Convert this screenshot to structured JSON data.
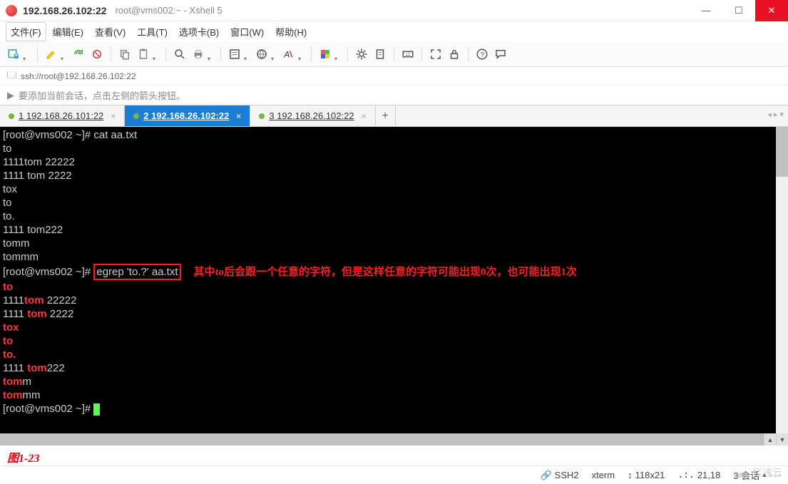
{
  "window": {
    "title_main": "192.168.26.102:22",
    "title_sub": "root@vms002:~ - Xshell 5"
  },
  "menus": [
    "文件(F)",
    "编辑(E)",
    "查看(V)",
    "工具(T)",
    "选项卡(B)",
    "窗口(W)",
    "帮助(H)"
  ],
  "address": "ssh://root@192.168.26.102:22",
  "hint": "要添加当前会话，点击左侧的箭头按钮。",
  "tabs": [
    {
      "label": "1 192.168.26.101:22",
      "active": false
    },
    {
      "label": "2 192.168.26.102:22",
      "active": true
    },
    {
      "label": "3 192.168.26.102:22",
      "active": false
    }
  ],
  "terminal": {
    "prompt1": "[root@vms002 ~]# ",
    "cmd1": "cat aa.txt",
    "out1": [
      "to",
      "1111tom 22222",
      "1111 tom 2222",
      "tox",
      "to",
      "to.",
      "1111 tom222",
      "tomm",
      "tommm"
    ],
    "prompt2": "[root@vms002 ~]# ",
    "cmd2": "egrep 'to.?' aa.txt",
    "annotation": "其中to后会跟一个任意的字符，但是这样任意的字符可能出现0次，也可能出现1次",
    "egrep_lines": [
      {
        "pre": "",
        "hl": "to",
        "post": ""
      },
      {
        "pre": "1111",
        "hl": "tom ",
        "post": "22222"
      },
      {
        "pre": "1111 ",
        "hl": "tom ",
        "post": "2222"
      },
      {
        "pre": "",
        "hl": "tox",
        "post": ""
      },
      {
        "pre": "",
        "hl": "to",
        "post": ""
      },
      {
        "pre": "",
        "hl": "to.",
        "post": ""
      },
      {
        "pre": "1111 ",
        "hl": "tom",
        "post": "222"
      },
      {
        "pre": "",
        "hl": "tom",
        "post": "m"
      },
      {
        "pre": "",
        "hl": "tom",
        "post": "mm"
      }
    ],
    "prompt3": "[root@vms002 ~]# "
  },
  "figure_label": "图1-23",
  "status": {
    "proto": "SSH2",
    "term": "xterm",
    "size": "118x21",
    "pos": "21,18",
    "sessions": "3 会话"
  },
  "watermark": "亿速云"
}
